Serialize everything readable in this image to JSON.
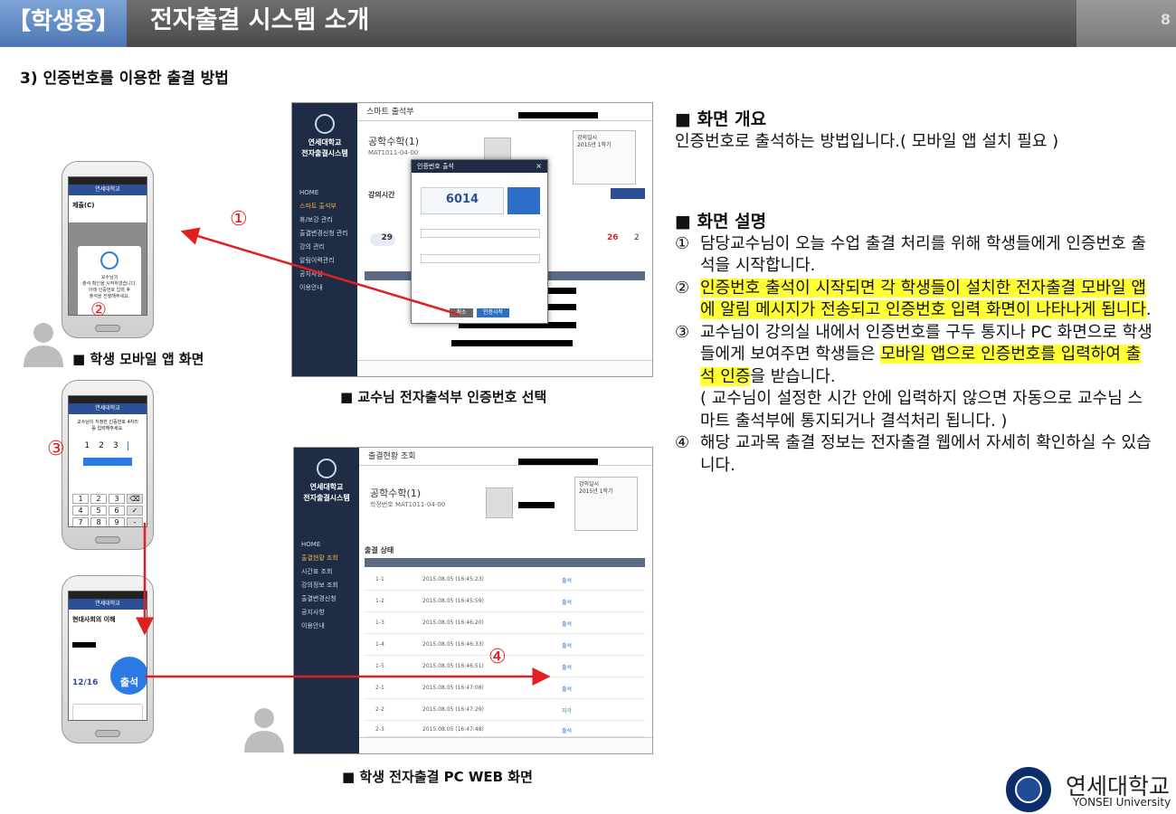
{
  "header": {
    "tag": "【학생용】",
    "title": "전자출결 시스템 소개",
    "page_number": "8"
  },
  "section_title": "3) 인증번호를 이용한 출결 방법",
  "captions": {
    "mobile_app": "■ 학생 모바일 앱 화면",
    "professor_web": "■ 교수님 전자출석부 인증번호 선택",
    "student_web": "■ 학생 전자출결 PC WEB 화면"
  },
  "markers": {
    "m1": "①",
    "m2": "②",
    "m3": "③",
    "m4": "④"
  },
  "professor_screen": {
    "page_title": "스마트 출석부",
    "school": "연세대학교",
    "system": "전자출결시스템",
    "course_name": "공학수학(1)",
    "course_code": "MAT1011-04-00",
    "menu": [
      "HOME",
      "스마트 출석부",
      "휴/보강 관리",
      "출결변경신청 관리",
      "강의 관리",
      "알림이력관리",
      "공지사항",
      "이용안내"
    ],
    "modal_title": "인증번호 출석",
    "auth_code": "6014",
    "modal_buttons": [
      "취소",
      "인증시작"
    ],
    "present_count": "29",
    "late_count": "26",
    "absent_count": "2"
  },
  "student_screen": {
    "page_title": "출결현황 조회",
    "school": "연세대학교",
    "system": "전자출결시스템",
    "course_name": "공학수학(1)",
    "course_code": "학정번호 MAT1011-04-00",
    "menu": [
      "HOME",
      "출결현황 조회",
      "시간표 조회",
      "강의정보 조회",
      "출결변경신청",
      "공지사항",
      "이용안내"
    ],
    "section": "출결 상태",
    "rows": [
      {
        "week": "1-1",
        "time": "2015.08.05 (16:45:23)",
        "status": "출석"
      },
      {
        "week": "1-2",
        "time": "2015.08.05 (16:45:59)",
        "status": "출석"
      },
      {
        "week": "1-3",
        "time": "2015.08.05 (16:46:20)",
        "status": "출석"
      },
      {
        "week": "1-4",
        "time": "2015.08.05 (16:46:33)",
        "status": "출석"
      },
      {
        "week": "1-5",
        "time": "2015.08.05 (16:46:51)",
        "status": "출석"
      },
      {
        "week": "2-1",
        "time": "2015.08.05 (16:47:08)",
        "status": "출석"
      },
      {
        "week": "2-2",
        "time": "2015.08.05 (16:47:29)",
        "status": "지각"
      },
      {
        "week": "2-3",
        "time": "2015.08.05 (16:47:48)",
        "status": "출석"
      }
    ]
  },
  "phones": {
    "p1_course": "제출(C)",
    "p2_prompt": "교수님이 지정한 인증번호 4자리를 입력해주세요.",
    "p2_digits": [
      "1",
      "2",
      "3",
      ""
    ],
    "p2_keys": [
      "1",
      "2",
      "3",
      "4",
      "5",
      "6",
      "7",
      "8",
      "9",
      "0"
    ],
    "p3_course": "현대사회의 이해",
    "p3_button": "출석",
    "p3_progress": "12/16"
  },
  "description": {
    "overview_heading": "■ 화면 개요",
    "overview_text": "인증번호로 출석하는 방법입니다.( 모바일 앱 설치 필요 )",
    "detail_heading": "■ 화면 설명",
    "item1_num": "①",
    "item1": "담당교수님이 오늘 수업 출결 처리를 위해 학생들에게 인증번호 출석을 시작합니다.",
    "item2_num": "②",
    "item2": "인증번호 출석이 시작되면 각 학생들이 설치한 전자출결 모바일 앱에 알림 메시지가 전송되고 인증번호 입력 화면이 나타나게 됩니다",
    "item2_end": ".",
    "item3_num": "③",
    "item3_a": "교수님이 강의실 내에서 인증번호를 구두 통지나 PC 화면으로 학생들에게 보여주면 학생들은 ",
    "item3_hl": "모바일 앱으로 인증번호를 입력하여 출석 인증",
    "item3_b": "을 받습니다.",
    "item3_note": "( 교수님이 설정한 시간 안에 입력하지 않으면 자동으로 교수님 스마트 출석부에 통지되거나 결석처리 됩니다. )",
    "item4_num": "④",
    "item4": "해당 교과목 출결 정보는 전자출결 웹에서 자세히 확인하실 수 있습니다."
  },
  "logo": {
    "korean": "연세대학교",
    "english": "YONSEI University"
  },
  "colors": {
    "header_tag": "#4d76b4",
    "header_bar": "#555555",
    "highlight": "#ffff33",
    "arrow": "#e02020",
    "sidebar": "#1f2c45"
  }
}
